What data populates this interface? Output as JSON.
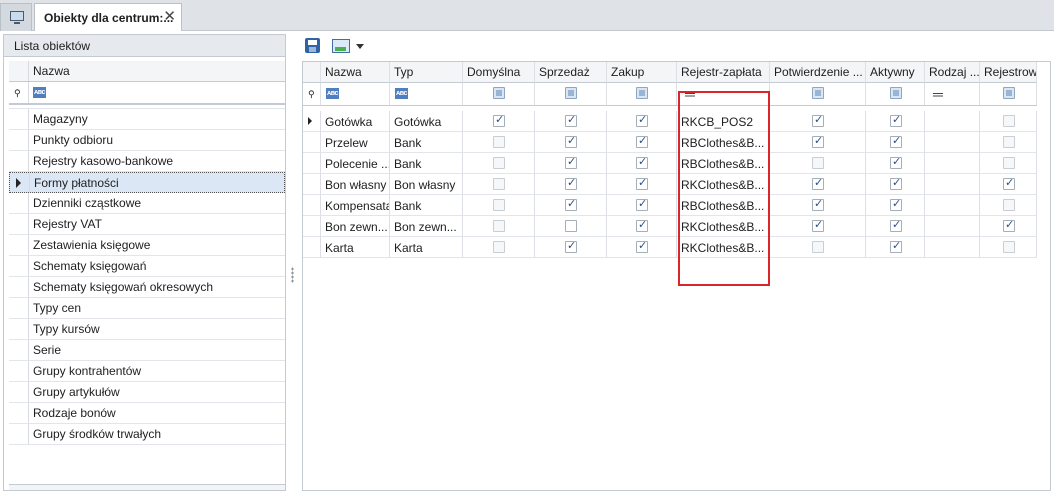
{
  "tab": {
    "title": "Obiekty dla centrum:...",
    "close": "✕"
  },
  "left_panel": {
    "title": "Lista obiektów",
    "column_header": "Nazwa",
    "items": [
      "Magazyny",
      "Punkty odbioru",
      "Rejestry kasowo-bankowe",
      "Formy płatności",
      "Dzienniki cząstkowe",
      "Rejestry VAT",
      "Zestawienia księgowe",
      "Schematy księgowań",
      "Schematy księgowań okresowych",
      "Typy cen",
      "Typy kursów",
      "Serie",
      "Grupy kontrahentów",
      "Grupy artykułów",
      "Rodzaje bonów",
      "Grupy środków trwałych"
    ],
    "selected_index": 3
  },
  "filter": {
    "abc": "ᴀʙᴄ",
    "equals": "═",
    "pin": "⚲"
  },
  "grid": {
    "columns": [
      "Nazwa",
      "Typ",
      "Domyślna",
      "Sprzedaż",
      "Zakup",
      "Rejestr-zapłata",
      "Potwierdzenie ...",
      "Aktywny",
      "Rodzaj ...",
      "Rejestrow..."
    ],
    "rows": [
      {
        "nazwa": "Gotówka",
        "typ": "Gotówka",
        "domyslna": true,
        "sprzedaz": true,
        "zakup": true,
        "rejestr": "RKCB_POS2",
        "potwierdzenie": true,
        "aktywny": true,
        "rodzaj": "",
        "rejestrow": false,
        "current": true
      },
      {
        "nazwa": "Przelew",
        "typ": "Bank",
        "domyslna": false,
        "sprzedaz": true,
        "zakup": true,
        "rejestr": "RBClothes&B...",
        "potwierdzenie": true,
        "aktywny": true,
        "rodzaj": "",
        "rejestrow": false
      },
      {
        "nazwa": "Polecenie ...",
        "typ": "Bank",
        "domyslna": false,
        "sprzedaz": true,
        "zakup": true,
        "rejestr": "RBClothes&B...",
        "potwierdzenie": false,
        "aktywny": true,
        "rodzaj": "",
        "rejestrow": false
      },
      {
        "nazwa": "Bon własny",
        "typ": "Bon własny",
        "domyslna": false,
        "sprzedaz": true,
        "zakup": true,
        "rejestr": "RKClothes&B...",
        "potwierdzenie": true,
        "aktywny": true,
        "rodzaj": "",
        "rejestrow": true
      },
      {
        "nazwa": "Kompensata",
        "typ": "Bank",
        "domyslna": false,
        "sprzedaz": true,
        "zakup": true,
        "rejestr": "RBClothes&B...",
        "potwierdzenie": true,
        "aktywny": true,
        "rodzaj": "",
        "rejestrow": false
      },
      {
        "nazwa": "Bon zewn...",
        "typ": "Bon zewn...",
        "domyslna": false,
        "sprzedaz": false,
        "zakup": true,
        "rejestr": "RKClothes&B...",
        "potwierdzenie": true,
        "aktywny": true,
        "rodzaj": "",
        "rejestrow": true
      },
      {
        "nazwa": "Karta",
        "typ": "Karta",
        "domyslna": false,
        "sprzedaz": true,
        "zakup": true,
        "rejestr": "RKClothes&B...",
        "potwierdzenie": false,
        "aktywny": true,
        "rodzaj": "",
        "rejestrow": false
      }
    ]
  },
  "colors": {
    "highlight_border": "#d8262a",
    "selection": "#dbe7f5"
  }
}
